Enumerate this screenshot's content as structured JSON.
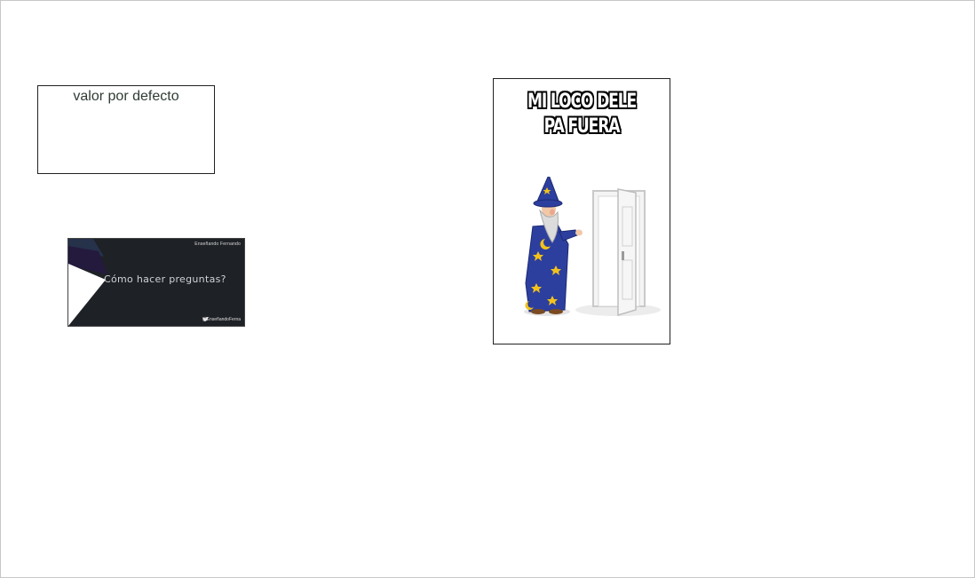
{
  "textbox": {
    "value": "valor por defecto"
  },
  "banner": {
    "site": "Enseñando Fernando",
    "title": "Cómo hacer preguntas?",
    "handle": "@EnseñandoFerna",
    "icon": "twitter-bird-icon"
  },
  "meme": {
    "line1": "MI LOCO DELE",
    "line2": "PA FUERA",
    "image": "wizard-opening-door"
  },
  "colors": {
    "banner_bg": "#1e2126",
    "robe": "#2d3f9e",
    "stars": "#f2c21a"
  }
}
